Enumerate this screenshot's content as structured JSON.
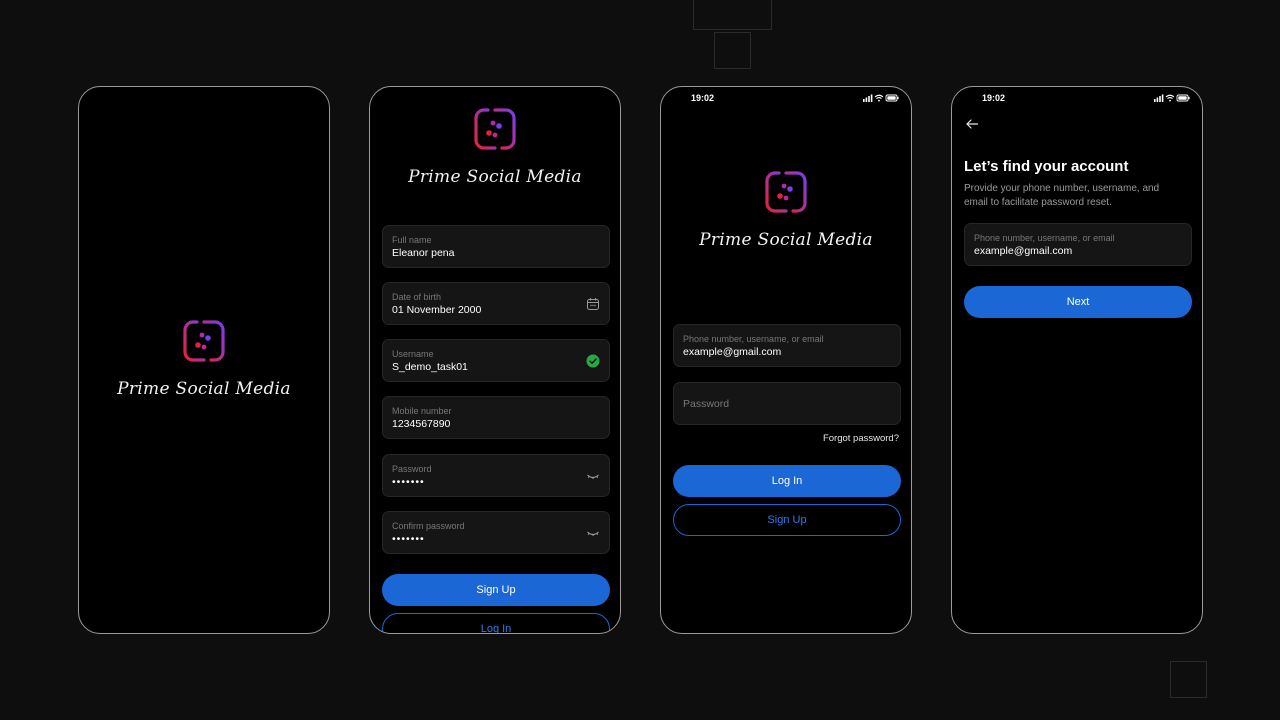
{
  "app": {
    "brand_name": "Prime Social Media"
  },
  "colors": {
    "accent": "#1b67d6",
    "background": "#0e0e0e",
    "field_bg": "#151515",
    "success": "#27a844"
  },
  "status_bar": {
    "time": "19:02"
  },
  "splash": {
    "logo_icon": "app-logo-icon"
  },
  "signup": {
    "fields": {
      "full_name": {
        "label": "Full name",
        "value": "Eleanor pena"
      },
      "dob": {
        "label": "Date of birth",
        "value": "01 November 2000",
        "icon": "calendar-icon"
      },
      "username": {
        "label": "Username",
        "value": "S_demo_task01",
        "icon": "check-circle-icon"
      },
      "mobile": {
        "label": "Mobile number",
        "value": "1234567890"
      },
      "password": {
        "label": "Password",
        "value": "•••••••",
        "icon": "eye-closed-icon"
      },
      "confirm_password": {
        "label": "Confirm password",
        "value": "•••••••",
        "icon": "eye-closed-icon"
      }
    },
    "primary_button": "Sign Up",
    "secondary_button": "Log In"
  },
  "login": {
    "identifier": {
      "label": "Phone number, username, or email",
      "value": "example@gmail.com"
    },
    "password": {
      "placeholder": "Password"
    },
    "forgot_link": "Forgot password?",
    "primary_button": "Log In",
    "secondary_button": "Sign Up"
  },
  "recover": {
    "back_icon": "arrow-left-icon",
    "title": "Let’s find your account",
    "description": "Provide your phone number, username, and email to facilitate password reset.",
    "identifier": {
      "label": "Phone number, username, or email",
      "value": "example@gmail.com"
    },
    "primary_button": "Next"
  }
}
